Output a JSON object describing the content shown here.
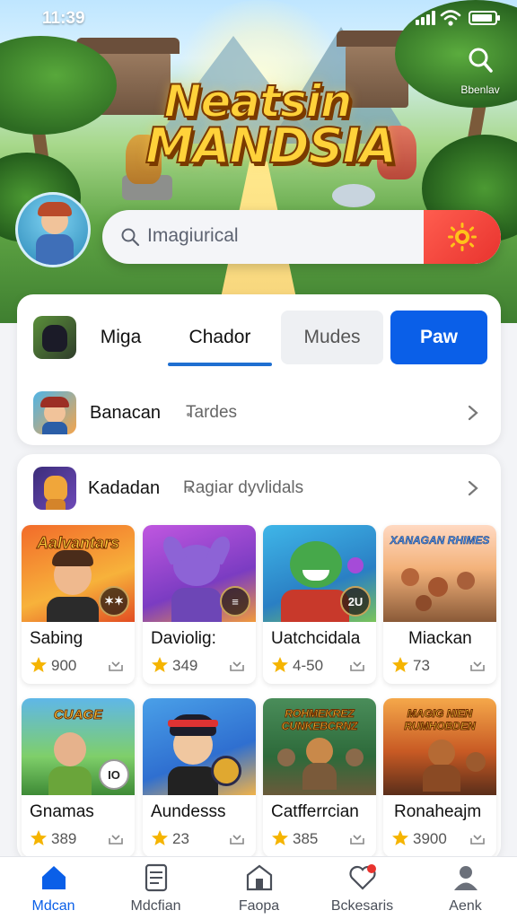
{
  "status_bar": {
    "time": "11:39"
  },
  "hero": {
    "account_label": "Bbenlav",
    "logo_line1": "Neatsin",
    "logo_line2": "MANDSIA",
    "search_placeholder": "Imagiurical"
  },
  "tabs": {
    "items": [
      {
        "label": "Miga",
        "state": "plain"
      },
      {
        "label": "Chador",
        "state": "underlined"
      },
      {
        "label": "Mudes",
        "state": "gray"
      },
      {
        "label": "Paw",
        "state": "primary"
      }
    ]
  },
  "rows": [
    {
      "title": "Banacan",
      "subtitle": "Tardes"
    },
    {
      "title": "Kadadan",
      "subtitle": "Ragiar dyvlidals"
    }
  ],
  "games": [
    {
      "name": "Sabing",
      "rating": "900",
      "art_title": "Aalvantars",
      "badge": "✶✶"
    },
    {
      "name": "Daviolig:",
      "rating": "349",
      "art_title": "",
      "badge": "≡"
    },
    {
      "name": "Uatchcidala",
      "rating": "4-50",
      "art_title": "",
      "badge": "2U"
    },
    {
      "name": "Miackan",
      "rating": "73",
      "art_title": "XANAGAN RHIMES",
      "badge": ""
    },
    {
      "name": "Gnamas",
      "rating": "389",
      "art_title": "CUAGE",
      "badge": "IO"
    },
    {
      "name": "Aundesss",
      "rating": "23",
      "art_title": "",
      "badge": ""
    },
    {
      "name": "Catfferrcian",
      "rating": "385",
      "art_title": "ROHMEKREZ CUNKEBCRNZ",
      "badge": ""
    },
    {
      "name": "Ronaheajm",
      "rating": "3900",
      "art_title": "MAGIG NIEN RUMHOBDEN",
      "badge": ""
    }
  ],
  "bottom_nav": [
    {
      "label": "Mdcan",
      "icon": "home-icon",
      "active": true
    },
    {
      "label": "Mdcfian",
      "icon": "document-icon",
      "active": false
    },
    {
      "label": "Faopa",
      "icon": "store-icon",
      "active": false
    },
    {
      "label": "Bckesaris",
      "icon": "heart-icon",
      "active": false
    },
    {
      "label": "Aenk",
      "icon": "profile-icon",
      "active": false
    }
  ],
  "colors": {
    "accent": "#0a5fe8",
    "search_button": "#e8332e",
    "star": "#f5b400"
  }
}
